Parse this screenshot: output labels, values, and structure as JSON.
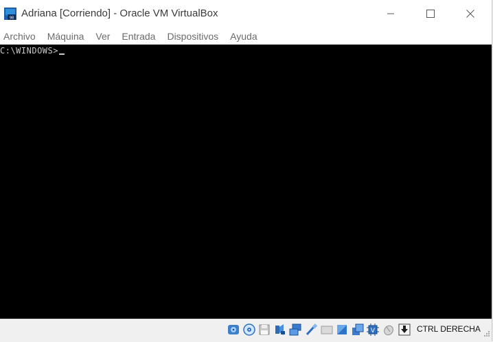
{
  "window": {
    "title": "Adriana [Corriendo] - Oracle VM VirtualBox"
  },
  "menu": [
    "Archivo",
    "Máquina",
    "Ver",
    "Entrada",
    "Dispositivos",
    "Ayuda"
  ],
  "console": {
    "prompt": "C:\\WINDOWS>"
  },
  "statusbar": {
    "icons": [
      "hard-disk-icon",
      "optical-disk-icon",
      "floppy-icon",
      "audio-icon",
      "network-icon",
      "usb-icon",
      "shared-folders-icon",
      "display-icon",
      "video-capture-icon",
      "cpu-virtualization-icon",
      "mouse-integration-icon",
      "keyboard-capture-icon"
    ],
    "host_key": "CTRL DERECHA"
  },
  "colors": {
    "screen": "#000000",
    "console_text": "#c8c8c8",
    "statusbar": "#f0f0f0"
  }
}
